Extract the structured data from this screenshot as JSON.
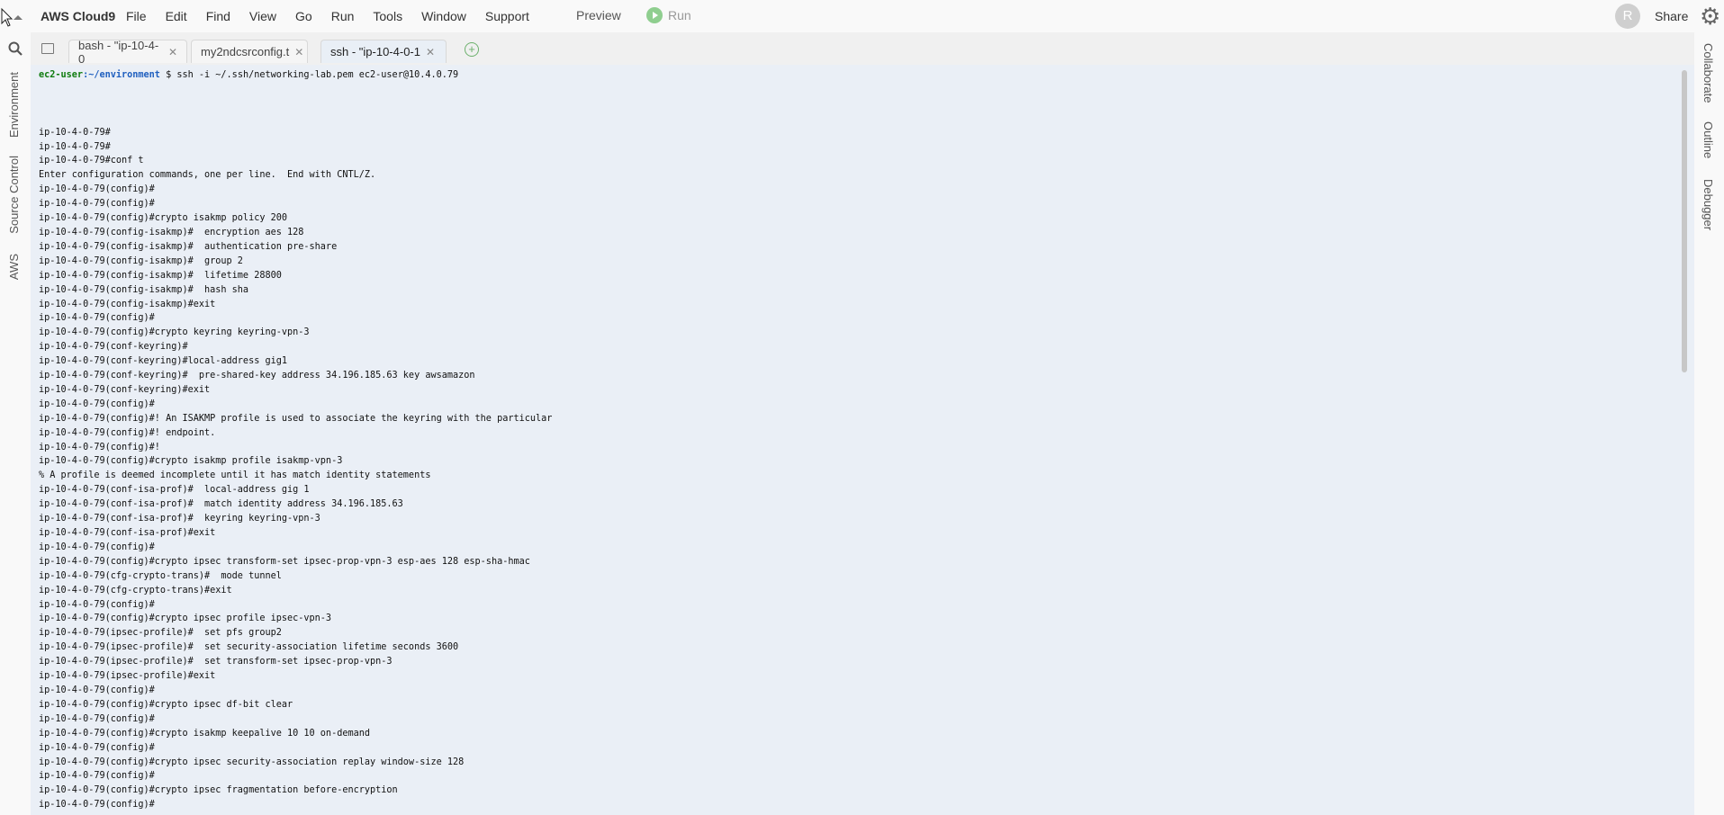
{
  "app": {
    "brand": "AWS Cloud9",
    "menu": [
      "File",
      "Edit",
      "Find",
      "View",
      "Go",
      "Run",
      "Tools",
      "Window",
      "Support"
    ],
    "preview": "Preview",
    "run": "Run",
    "avatar_initial": "R",
    "share": "Share"
  },
  "left_panel": {
    "tabs": [
      "Environment",
      "Source Control",
      "AWS"
    ]
  },
  "right_panel": {
    "tabs": [
      "Collaborate",
      "Outline",
      "Debugger"
    ]
  },
  "tabs": [
    {
      "label": "bash - \"ip-10-4-0",
      "active": false
    },
    {
      "label": "my2ndcsrconfig.t",
      "active": false
    },
    {
      "label": "ssh - \"ip-10-4-0-1",
      "active": true
    }
  ],
  "terminal": {
    "prompt_user": "ec2-user",
    "prompt_path": ":~/environment",
    "prompt_cmd": " $ ssh -i ~/.ssh/networking-lab.pem ec2-user@10.4.0.79",
    "lines": [
      "",
      "",
      "",
      "ip-10-4-0-79#",
      "ip-10-4-0-79#",
      "ip-10-4-0-79#conf t",
      "Enter configuration commands, one per line.  End with CNTL/Z.",
      "ip-10-4-0-79(config)#",
      "ip-10-4-0-79(config)#",
      "ip-10-4-0-79(config)#crypto isakmp policy 200",
      "ip-10-4-0-79(config-isakmp)#  encryption aes 128",
      "ip-10-4-0-79(config-isakmp)#  authentication pre-share",
      "ip-10-4-0-79(config-isakmp)#  group 2",
      "ip-10-4-0-79(config-isakmp)#  lifetime 28800",
      "ip-10-4-0-79(config-isakmp)#  hash sha",
      "ip-10-4-0-79(config-isakmp)#exit",
      "ip-10-4-0-79(config)#",
      "ip-10-4-0-79(config)#crypto keyring keyring-vpn-3",
      "ip-10-4-0-79(conf-keyring)#",
      "ip-10-4-0-79(conf-keyring)#local-address gig1",
      "ip-10-4-0-79(conf-keyring)#  pre-shared-key address 34.196.185.63 key awsamazon",
      "ip-10-4-0-79(conf-keyring)#exit",
      "ip-10-4-0-79(config)#",
      "ip-10-4-0-79(config)#! An ISAKMP profile is used to associate the keyring with the particular",
      "ip-10-4-0-79(config)#! endpoint.",
      "ip-10-4-0-79(config)#!",
      "ip-10-4-0-79(config)#crypto isakmp profile isakmp-vpn-3",
      "% A profile is deemed incomplete until it has match identity statements",
      "ip-10-4-0-79(conf-isa-prof)#  local-address gig 1",
      "ip-10-4-0-79(conf-isa-prof)#  match identity address 34.196.185.63",
      "ip-10-4-0-79(conf-isa-prof)#  keyring keyring-vpn-3",
      "ip-10-4-0-79(conf-isa-prof)#exit",
      "ip-10-4-0-79(config)#",
      "ip-10-4-0-79(config)#crypto ipsec transform-set ipsec-prop-vpn-3 esp-aes 128 esp-sha-hmac",
      "ip-10-4-0-79(cfg-crypto-trans)#  mode tunnel",
      "ip-10-4-0-79(cfg-crypto-trans)#exit",
      "ip-10-4-0-79(config)#",
      "ip-10-4-0-79(config)#crypto ipsec profile ipsec-vpn-3",
      "ip-10-4-0-79(ipsec-profile)#  set pfs group2",
      "ip-10-4-0-79(ipsec-profile)#  set security-association lifetime seconds 3600",
      "ip-10-4-0-79(ipsec-profile)#  set transform-set ipsec-prop-vpn-3",
      "ip-10-4-0-79(ipsec-profile)#exit",
      "ip-10-4-0-79(config)#",
      "ip-10-4-0-79(config)#crypto ipsec df-bit clear",
      "ip-10-4-0-79(config)#",
      "ip-10-4-0-79(config)#crypto isakmp keepalive 10 10 on-demand",
      "ip-10-4-0-79(config)#",
      "ip-10-4-0-79(config)#crypto ipsec security-association replay window-size 128",
      "ip-10-4-0-79(config)#",
      "ip-10-4-0-79(config)#crypto ipsec fragmentation before-encryption",
      "ip-10-4-0-79(config)#"
    ]
  },
  "colors": {
    "terminal_bg": "#eaeff6",
    "prompt_user": "#0e7b0e",
    "prompt_path": "#1f5fbf",
    "run_green": "#8fce8f"
  }
}
